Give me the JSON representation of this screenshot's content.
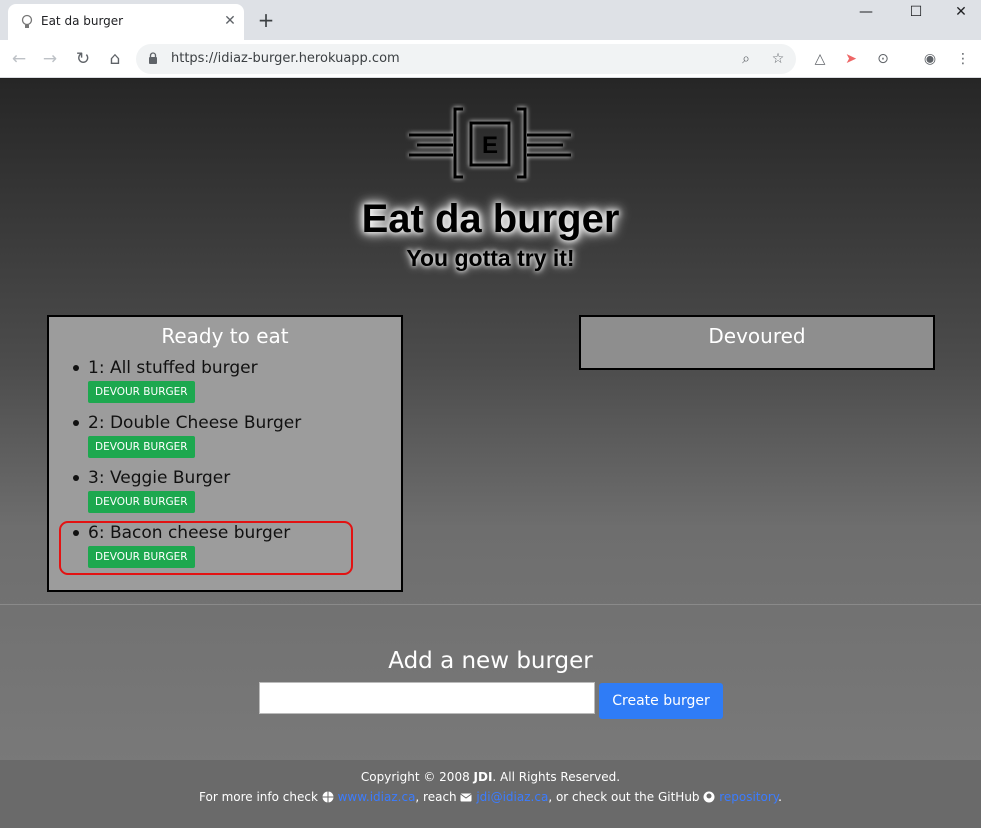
{
  "browser": {
    "tab_title": "Eat da burger",
    "url": "https://idiaz-burger.herokuapp.com"
  },
  "header": {
    "logo_letter": "E",
    "title": "Eat da burger",
    "subtitle": "You gotta try it!"
  },
  "ready": {
    "heading": "Ready to eat",
    "items": [
      {
        "name": "1: All stuffed burger",
        "button": "DEVOUR BURGER"
      },
      {
        "name": "2: Double Cheese Burger",
        "button": "DEVOUR BURGER"
      },
      {
        "name": "3: Veggie Burger",
        "button": "DEVOUR BURGER"
      },
      {
        "name": "6: Bacon cheese burger",
        "button": "DEVOUR BURGER"
      }
    ]
  },
  "devoured": {
    "heading": "Devoured"
  },
  "add": {
    "heading": "Add a new burger",
    "input_value": "",
    "button": "Create burger"
  },
  "footer": {
    "copyright_pre": "Copyright © 2008 ",
    "brand": "JDI",
    "copyright_post": ". All Rights Reserved.",
    "info_pre": "For more info check ",
    "site_link": "www.idiaz.ca",
    "reach": ", reach ",
    "email_link": "jdi@idiaz.ca",
    "github_text": ", or check out the GitHub ",
    "repo_link": "repository",
    "period": "."
  },
  "colors": {
    "devour_button": "#1da84f",
    "create_button": "#2f7cf6",
    "highlight": "#e31212",
    "link": "#3b7cff"
  }
}
